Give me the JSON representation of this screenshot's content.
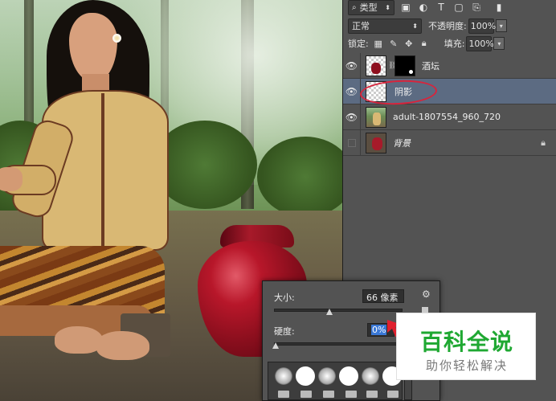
{
  "panel": {
    "filter": {
      "icon": "search-icon",
      "label": "类型"
    },
    "blend_mode": "正常",
    "opacity": {
      "label": "不透明度:",
      "value": "100%"
    },
    "lock": {
      "label": "锁定:"
    },
    "fill": {
      "label": "填充:",
      "value": "100%"
    }
  },
  "layers": [
    {
      "name": "酒坛",
      "visible": true,
      "has_mask": true
    },
    {
      "name": "阴影",
      "visible": true,
      "selected": true
    },
    {
      "name": "adult-1807554_960_720",
      "visible": true
    },
    {
      "name": "背景",
      "visible": false,
      "locked": true
    }
  ],
  "brush": {
    "size_label": "大小:",
    "size_value": "66 像素",
    "hardness_label": "硬度:",
    "hardness_value": "0%",
    "size_fraction": 0.43,
    "hardness_fraction": 0.0
  },
  "watermark": {
    "title": "百科全说",
    "subtitle": "助你轻松解决"
  },
  "colors": {
    "selection": "#5c6b82",
    "annotation": "#d8243c",
    "watermark_green": "#1fa832"
  }
}
